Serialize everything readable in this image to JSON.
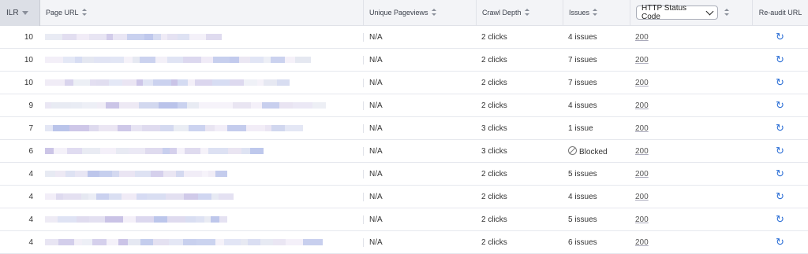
{
  "headers": {
    "ilr": "ILR",
    "url": "Page URL",
    "pageviews": "Unique Pageviews",
    "depth": "Crawl Depth",
    "issues": "Issues",
    "status": "HTTP Status Code",
    "reaudit": "Re-audit URL"
  },
  "rows": [
    {
      "ilr": "10",
      "pageviews": "N/A",
      "depth": "2 clicks",
      "issues": "4 issues",
      "status": "200",
      "blocked": false
    },
    {
      "ilr": "10",
      "pageviews": "N/A",
      "depth": "2 clicks",
      "issues": "7 issues",
      "status": "200",
      "blocked": false
    },
    {
      "ilr": "10",
      "pageviews": "N/A",
      "depth": "2 clicks",
      "issues": "7 issues",
      "status": "200",
      "blocked": false
    },
    {
      "ilr": "9",
      "pageviews": "N/A",
      "depth": "2 clicks",
      "issues": "4 issues",
      "status": "200",
      "blocked": false
    },
    {
      "ilr": "7",
      "pageviews": "N/A",
      "depth": "3 clicks",
      "issues": "1 issue",
      "status": "200",
      "blocked": false
    },
    {
      "ilr": "6",
      "pageviews": "N/A",
      "depth": "3 clicks",
      "issues": "Blocked",
      "status": "200",
      "blocked": true
    },
    {
      "ilr": "4",
      "pageviews": "N/A",
      "depth": "2 clicks",
      "issues": "5 issues",
      "status": "200",
      "blocked": false
    },
    {
      "ilr": "4",
      "pageviews": "N/A",
      "depth": "2 clicks",
      "issues": "4 issues",
      "status": "200",
      "blocked": false
    },
    {
      "ilr": "4",
      "pageviews": "N/A",
      "depth": "2 clicks",
      "issues": "5 issues",
      "status": "200",
      "blocked": false
    },
    {
      "ilr": "4",
      "pageviews": "N/A",
      "depth": "2 clicks",
      "issues": "6 issues",
      "status": "200",
      "blocked": false
    }
  ],
  "colors": {
    "accent": "#2c6fd6",
    "header_bg": "#f3f4f7",
    "blur_palette": [
      "#e9e4f2",
      "#ddd9ee",
      "#cfd5ee",
      "#c9c2e6",
      "#e4e7f1",
      "#b9c3ea",
      "#efeaf6"
    ]
  },
  "icons": {
    "reaudit": "refresh-icon",
    "blocked": "blocked-icon",
    "sort": "sort-icon"
  }
}
